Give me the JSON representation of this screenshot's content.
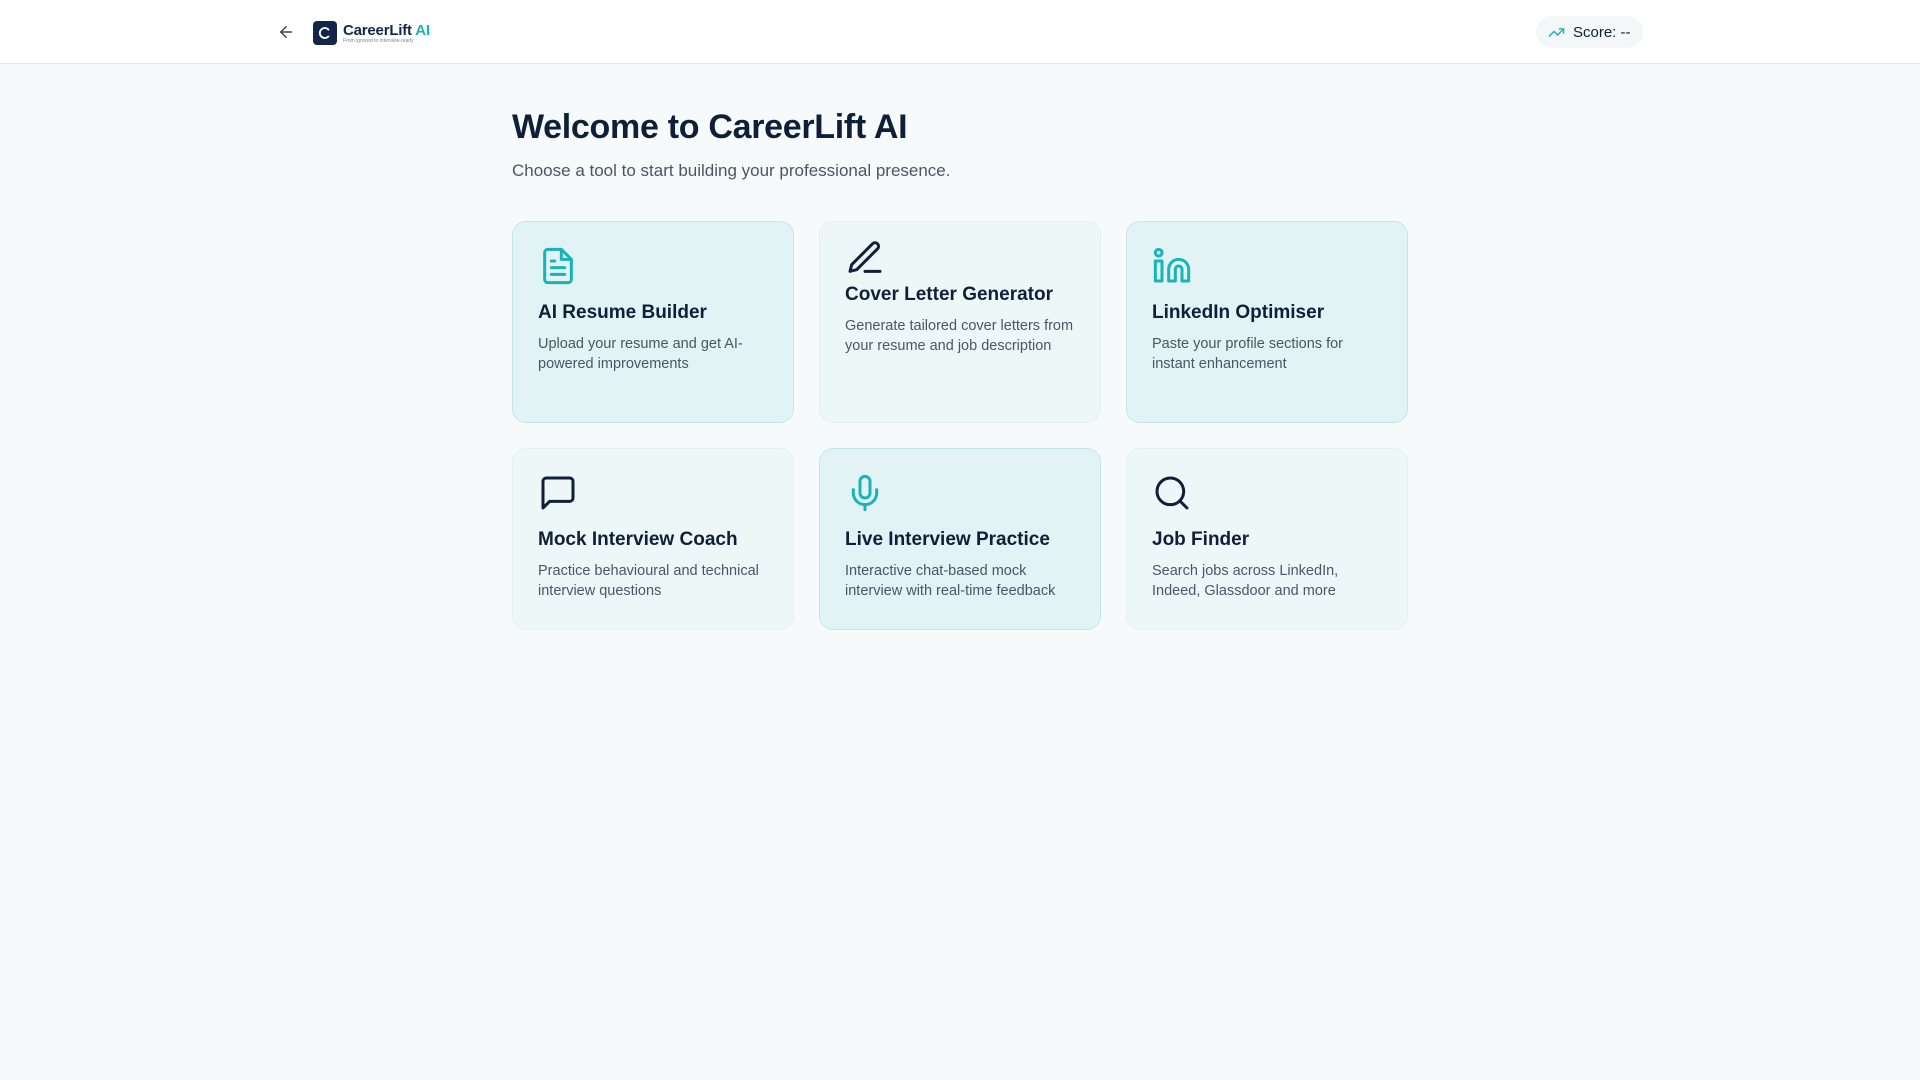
{
  "header": {
    "logo_name": "CareerLift",
    "logo_ai": "AI",
    "logo_tagline": "From ignored to interview-ready",
    "score_label": "Score: --"
  },
  "main": {
    "title": "Welcome to CareerLift AI",
    "subtitle": "Choose a tool to start building your professional presence."
  },
  "tools": [
    {
      "title": "AI Resume Builder",
      "description": "Upload your resume and get AI-powered improvements",
      "icon": "document-icon"
    },
    {
      "title": "Cover Letter Generator",
      "description": "Generate tailored cover letters from your resume and job description",
      "icon": "pen-icon"
    },
    {
      "title": "LinkedIn Optimiser",
      "description": "Paste your profile sections for instant enhancement",
      "icon": "linkedin-icon"
    },
    {
      "title": "Mock Interview Coach",
      "description": "Practice behavioural and technical interview questions",
      "icon": "chat-bubble-icon"
    },
    {
      "title": "Live Interview Practice",
      "description": "Interactive chat-based mock interview with real-time feedback",
      "icon": "microphone-icon"
    },
    {
      "title": "Job Finder",
      "description": "Search jobs across LinkedIn, Indeed, Glassdoor and more",
      "icon": "search-icon"
    }
  ],
  "colors": {
    "accent": "#19b3b8",
    "navy": "#0f1f3a",
    "card_teal": "#e1f3f5",
    "card_light": "#eef7f7",
    "background": "#f7fafb"
  }
}
